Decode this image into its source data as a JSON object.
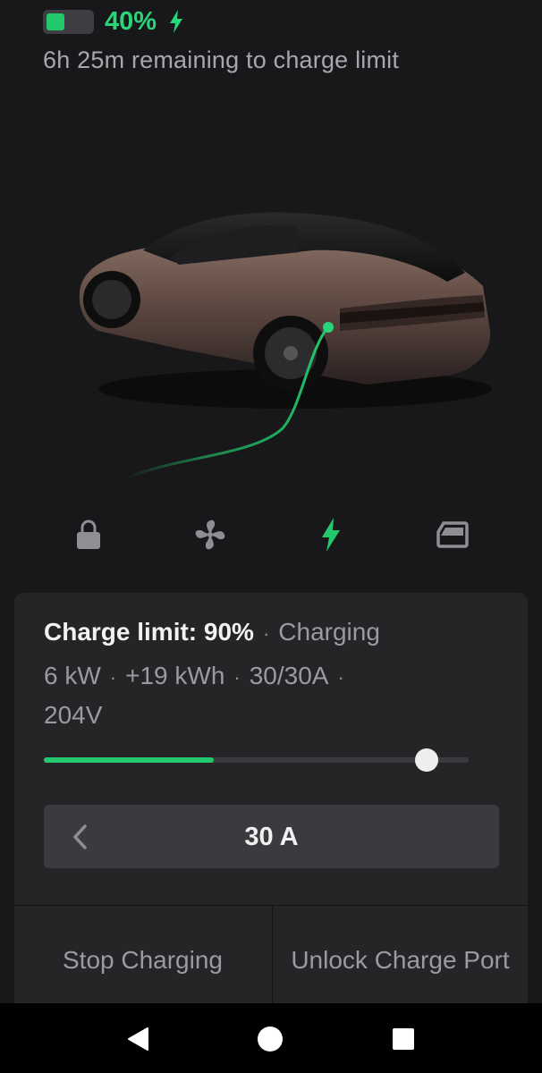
{
  "status": {
    "battery_percent": "40%",
    "battery_level": 0.4,
    "remaining": "6h 25m remaining to charge limit",
    "charging_icon": "bolt-icon"
  },
  "icons": {
    "lock": "lock-icon",
    "climate": "fan-icon",
    "charging": "bolt-icon",
    "frunk": "frunk-icon"
  },
  "charge": {
    "limit": "Charge limit: 90%",
    "state": "Charging",
    "power": "6 kW",
    "energy": "+19 kWh",
    "current": "30/30A",
    "voltage": "204V",
    "battery_level": 0.4,
    "limit_level": 0.9,
    "amps": "30 A"
  },
  "actions": {
    "stop": "Stop Charging",
    "unlock": "Unlock Charge Port"
  },
  "colors": {
    "accent_green": "#22c86b",
    "background": "#18181a",
    "panel": "#252528"
  }
}
